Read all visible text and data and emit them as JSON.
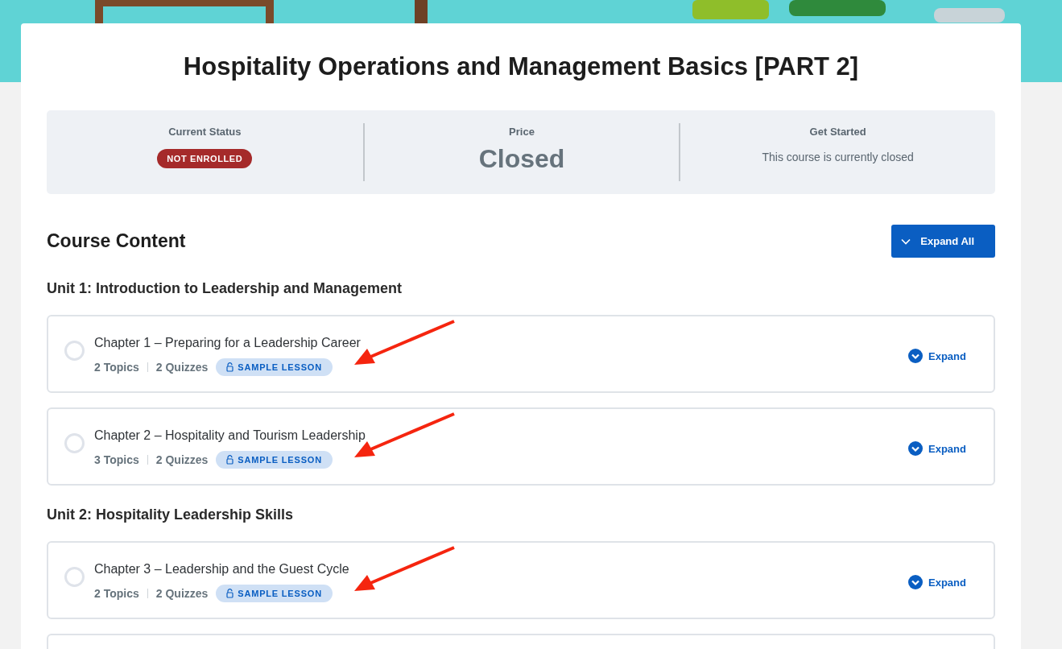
{
  "course": {
    "title": "Hospitality Operations and Management Basics [PART 2]"
  },
  "infobar": [
    {
      "kind": "badge",
      "label": "Current Status",
      "value": "NOT ENROLLED"
    },
    {
      "kind": "price",
      "label": "Price",
      "value": "Closed"
    },
    {
      "kind": "text",
      "label": "Get Started",
      "value": "This course is currently closed"
    }
  ],
  "content": {
    "heading": "Course Content",
    "expand_all": "Expand All",
    "units": [
      {
        "title": "Unit 1: Introduction to Leadership and Management",
        "lessons": [
          {
            "title": "Chapter 1 – Preparing for a Leadership Career",
            "topics": "2 Topics",
            "quizzes": "2 Quizzes",
            "badge": "SAMPLE LESSON",
            "completed": false,
            "annotated": true,
            "expand": "Expand"
          },
          {
            "title": "Chapter 2 – Hospitality and Tourism Leadership",
            "topics": "3 Topics",
            "quizzes": "2 Quizzes",
            "badge": "SAMPLE LESSON",
            "completed": false,
            "annotated": true,
            "expand": "Expand"
          }
        ]
      },
      {
        "title": "Unit 2: Hospitality Leadership Skills",
        "lessons": [
          {
            "title": "Chapter 3 – Leadership and the Guest Cycle",
            "topics": "2 Topics",
            "quizzes": "2 Quizzes",
            "badge": "SAMPLE LESSON",
            "completed": false,
            "annotated": true,
            "expand": "Expand"
          }
        ]
      }
    ]
  }
}
